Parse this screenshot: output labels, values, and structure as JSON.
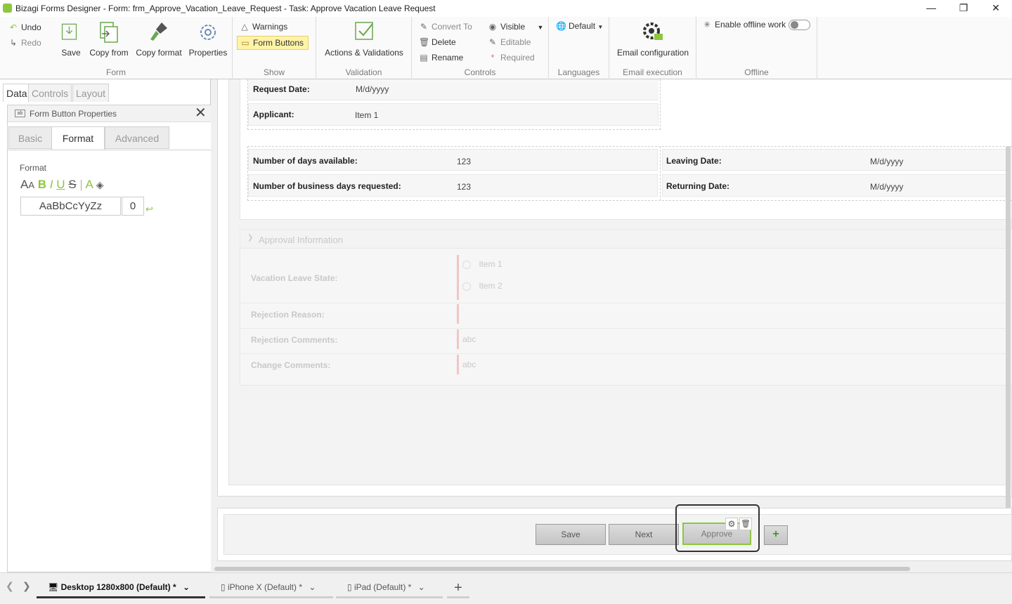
{
  "window": {
    "title": "Bizagi Forms Designer  - Form: frm_Approve_Vacation_Leave_Request - Task:  Approve Vacation Leave Request"
  },
  "ribbon": {
    "undo": "Undo",
    "redo": "Redo",
    "save": "Save",
    "copy_from": "Copy from",
    "copy_format": "Copy format",
    "properties": "Properties",
    "group_form": "Form",
    "warnings": "Warnings",
    "form_buttons": "Form Buttons",
    "group_show": "Show",
    "actions_validations": "Actions & Validations",
    "group_validation": "Validation",
    "convert_to": "Convert To",
    "delete": "Delete",
    "rename": "Rename",
    "visible": "Visible",
    "editable": "Editable",
    "required": "Required",
    "group_controls": "Controls",
    "default_lang": "Default",
    "group_languages": "Languages",
    "email_configuration": "Email configuration",
    "group_email": "Email execution",
    "enable_offline": "Enable offline work",
    "group_offline": "Offline"
  },
  "left_panel": {
    "tabs": [
      "Data",
      "Controls",
      "Layout"
    ],
    "prop_title": "Form Button Properties",
    "prop_tabs": [
      "Basic",
      "Format",
      "Advanced"
    ],
    "format_label": "Format",
    "format_preview": "AaBbCcYyZz",
    "format_value": "0"
  },
  "form": {
    "request_date_label": "Request Date:",
    "request_date_value": "M/d/yyyy",
    "applicant_label": "Applicant:",
    "applicant_value": "Item 1",
    "days_available_label": "Number of days available:",
    "days_available_value": "123",
    "business_days_label": "Number of business days requested:",
    "business_days_value": "123",
    "leaving_date_label": "Leaving Date:",
    "leaving_date_value": "M/d/yyyy",
    "returning_date_label": "Returning Date:",
    "returning_date_value": "M/d/yyyy",
    "approval_section": "Approval Information",
    "vacation_state_label": "Vacation Leave State:",
    "state_option_1": "Item 1",
    "state_option_2": "Item 2",
    "rejection_reason_label": "Rejection Reason:",
    "rejection_comments_label": "Rejection Comments:",
    "rejection_comments_value": "abc",
    "change_comments_label": "Change Comments:",
    "change_comments_value": "abc"
  },
  "form_buttons": {
    "save": "Save",
    "next": "Next",
    "approve": "Approve"
  },
  "bottom_tabs": [
    "Desktop 1280x800 (Default) *",
    "iPhone X (Default) *",
    "iPad (Default) *"
  ],
  "colors": {
    "accent_green": "#8dc63f",
    "highlight_yellow": "#fff3a8"
  }
}
